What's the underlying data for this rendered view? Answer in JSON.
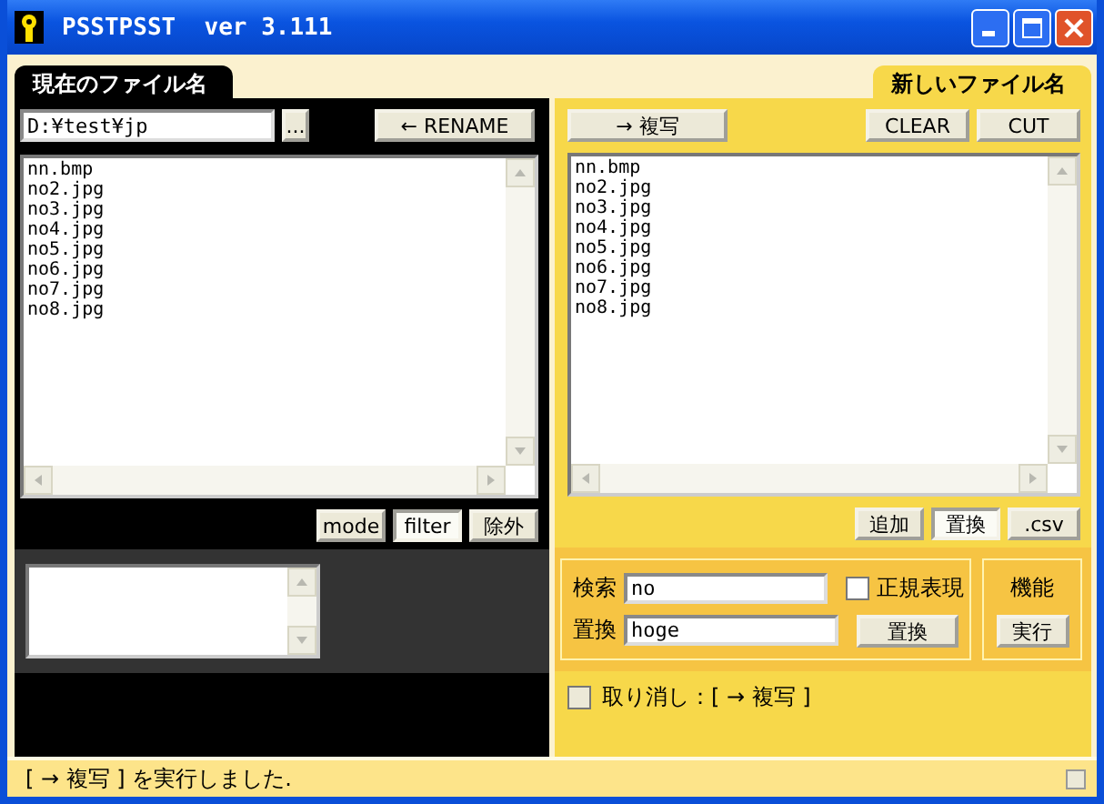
{
  "window": {
    "title": "PSSTPSST  ver 3.111"
  },
  "left_panel": {
    "tab": "現在のファイル名",
    "path": "D:¥test¥jp",
    "browse_button": "...",
    "rename_button": "← RENAME",
    "files": [
      "nn.bmp",
      "no2.jpg",
      "no3.jpg",
      "no4.jpg",
      "no5.jpg",
      "no6.jpg",
      "no7.jpg",
      "no8.jpg"
    ],
    "modes": [
      {
        "label": "mode",
        "selected": false
      },
      {
        "label": "filter",
        "selected": true
      },
      {
        "label": "除外",
        "selected": false
      }
    ]
  },
  "right_panel": {
    "tab": "新しいファイル名",
    "copy_button": "→ 複写",
    "clear_button": "CLEAR",
    "cut_button": "CUT",
    "files": [
      "nn.bmp",
      "no2.jpg",
      "no3.jpg",
      "no4.jpg",
      "no5.jpg",
      "no6.jpg",
      "no7.jpg",
      "no8.jpg"
    ],
    "modes": [
      {
        "label": "追加",
        "selected": false
      },
      {
        "label": "置換",
        "selected": true
      },
      {
        "label": ".csv",
        "selected": false
      }
    ],
    "search": {
      "label": "検索",
      "value": "no"
    },
    "replace": {
      "label": "置換",
      "value": "hoge"
    },
    "regex": {
      "label": "正規表現",
      "checked": false
    },
    "replace_button": "置換",
    "function": {
      "label": "機能",
      "button": "実行"
    },
    "undo": {
      "label": "取り消し：[ → 複写 ]",
      "checked": false
    }
  },
  "status_bar": {
    "text": "[ → 複写 ] を実行しました."
  }
}
